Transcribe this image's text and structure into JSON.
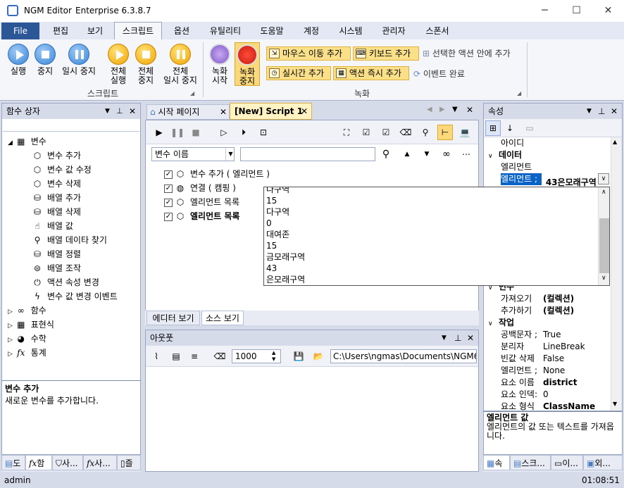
{
  "app": {
    "name": "NGM Editor",
    "edition": "Enterprise 6.3.8.7"
  },
  "window_controls": {
    "minimize": "─",
    "maximize": "☐",
    "close": "✕"
  },
  "menu": {
    "file": "File",
    "items": [
      "편집",
      "보기",
      "스크립트",
      "옵션",
      "유틸리티",
      "도움말",
      "계정",
      "시스템",
      "관리자",
      "스폰서"
    ],
    "active": "스크립트"
  },
  "ribbon": {
    "script_group": {
      "label": "스크립트",
      "buttons": [
        "실행",
        "중지",
        "일시 중지"
      ],
      "full_buttons": [
        [
          "전체",
          "실행"
        ],
        [
          "전체",
          "중지"
        ],
        [
          "전체",
          "일시 중지"
        ]
      ]
    },
    "record_group": {
      "label": "녹화",
      "start": [
        "녹화",
        "시작"
      ],
      "stop": [
        "녹화",
        "중지"
      ],
      "actions": [
        "마우스 이동 추가",
        "키보드 추가",
        "실시간 추가",
        "액션 즉시 추가"
      ],
      "insert_in_selected": "선택한 액션 안에 추가",
      "event_complete": "이벤트 완료"
    }
  },
  "function_panel": {
    "title": "함수 상자",
    "root": "변수",
    "items": [
      "변수 추가",
      "변수 값 수정",
      "변수 삭제",
      "배열 추가",
      "배열 삭제",
      "배열 값",
      "배열 데이타 찾기",
      "배열 정렬",
      "배열 조작",
      "액션 속성 변경",
      "변수 값 변경 이벤트"
    ],
    "categories": [
      "함수",
      "표현식",
      "수학",
      "통계"
    ],
    "desc_title": "변수 추가",
    "desc_text": "새로운 변수를 추가합니다.",
    "bottom_tabs": [
      "도",
      "함",
      "사...",
      "사...",
      "즐"
    ]
  },
  "editor": {
    "tabs": [
      "시작 페이지",
      "[New] Script 1"
    ],
    "filter_select": "변수 이름",
    "filter_value": "",
    "actions": [
      {
        "label": "변수 추가 ( 엘리먼트 )",
        "bold": false
      },
      {
        "label": "연결 ( 캠핑 )",
        "bold": false
      },
      {
        "label": "엘리먼트 목록",
        "bold": false
      },
      {
        "label": "엘리먼트 목록",
        "bold": true
      }
    ],
    "bottom_tabs": [
      "에디터 보기",
      "소스 보기"
    ]
  },
  "dropdown": {
    "lines": [
      "다구역",
      "15",
      "다구역",
      "0",
      "대여존",
      "15",
      "금모래구역",
      "43",
      "은모래구역"
    ]
  },
  "output": {
    "title": "아웃풋",
    "count": "1000",
    "path": "C:\\Users\\ngmas\\Documents\\NGM6\\"
  },
  "properties": {
    "title": "속성",
    "rows_top": [
      {
        "name": "아이디",
        "value": ""
      }
    ],
    "data_section": "데이터",
    "data_rows": [
      {
        "name": "엘리먼트",
        "value": ""
      },
      {
        "name": "엘리먼트 ;",
        "value": "43은모래구역"
      }
    ],
    "var_section": "변수",
    "var_rows": [
      {
        "name": "가져오기",
        "value": "(컬렉션)"
      },
      {
        "name": "추가하기",
        "value": "(컬렉션)"
      }
    ],
    "work_section": "작업",
    "work_rows": [
      {
        "name": "공백문자 ;",
        "value": "True",
        "bold": false
      },
      {
        "name": "분리자",
        "value": "LineBreak",
        "bold": false
      },
      {
        "name": "빈값 삭제",
        "value": "False",
        "bold": false
      },
      {
        "name": "엘리먼트 ;",
        "value": "None",
        "bold": false
      },
      {
        "name": "요소 이름",
        "value": "district",
        "bold": true
      },
      {
        "name": "요소 인덱:",
        "value": "0",
        "bold": false
      },
      {
        "name": "요소 형식",
        "value": "ClassName",
        "bold": true
      }
    ],
    "desc_title": "엘리먼트 값",
    "desc_text": "엘리먼트의 값 또는 텍스트를 가져옵니다.",
    "bottom_tabs": [
      "속",
      "스크...",
      "이...",
      "외..."
    ]
  },
  "status": {
    "user": "admin",
    "time": "01:08:51"
  },
  "colors": {
    "accent": "#2b5797",
    "ribbon_yellow": "#fbe08a",
    "selection": "#0a64c8"
  }
}
